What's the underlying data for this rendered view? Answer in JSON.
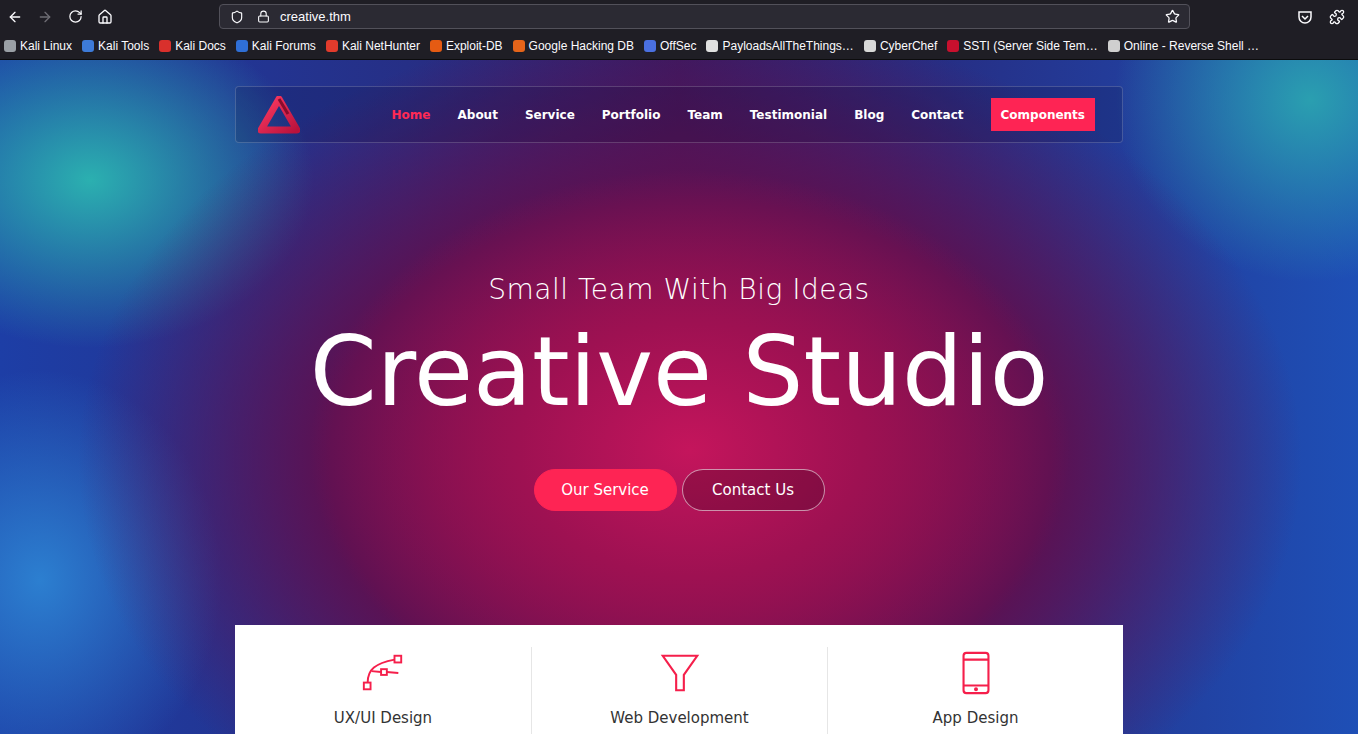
{
  "browser": {
    "back_enabled": true,
    "forward_enabled": false,
    "url": "creative.thm",
    "bookmarks": [
      {
        "label": "Kali Linux",
        "color": "#9aa0a6"
      },
      {
        "label": "Kali Tools",
        "color": "#3d7bd9"
      },
      {
        "label": "Kali Docs",
        "color": "#d9302c"
      },
      {
        "label": "Kali Forums",
        "color": "#2f6fd6"
      },
      {
        "label": "Kali NetHunter",
        "color": "#e23b2c"
      },
      {
        "label": "Exploit-DB",
        "color": "#e55b13"
      },
      {
        "label": "Google Hacking DB",
        "color": "#e5641a"
      },
      {
        "label": "OffSec",
        "color": "#4a6fe0"
      },
      {
        "label": "PayloadsAllTheThings…",
        "color": "#e0e0e0"
      },
      {
        "label": "CyberChef",
        "color": "#d8d8d8"
      },
      {
        "label": "SSTI (Server Side Tem…",
        "color": "#c8102e"
      },
      {
        "label": "Online - Reverse Shell …",
        "color": "#cfcfcf"
      }
    ]
  },
  "site": {
    "nav": [
      {
        "label": "Home",
        "selected": true
      },
      {
        "label": "About",
        "selected": false
      },
      {
        "label": "Service",
        "selected": false
      },
      {
        "label": "Portfolio",
        "selected": false
      },
      {
        "label": "Team",
        "selected": false
      },
      {
        "label": "Testimonial",
        "selected": false
      },
      {
        "label": "Blog",
        "selected": false
      },
      {
        "label": "Contact",
        "selected": false
      }
    ],
    "nav_button": "Components",
    "hero": {
      "subtitle": "Small Team With Big Ideas",
      "title": "Creative Studio",
      "buttons": [
        {
          "label": "Our Service",
          "kind": "filled"
        },
        {
          "label": "Contact Us",
          "kind": "outline"
        }
      ]
    },
    "services": [
      {
        "label": "UX/UI Design"
      },
      {
        "label": "Web Development"
      },
      {
        "label": "App Design"
      }
    ]
  }
}
